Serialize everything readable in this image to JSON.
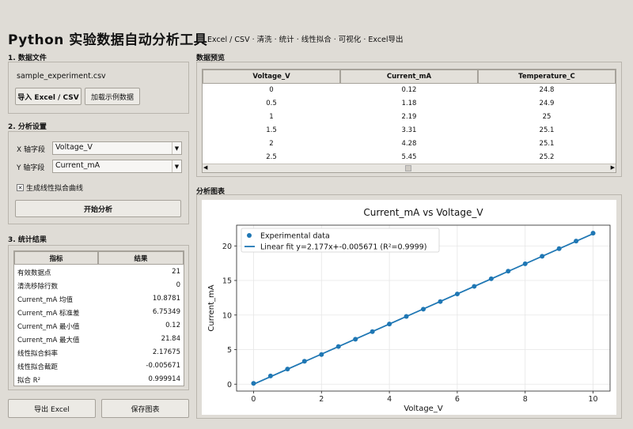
{
  "app": {
    "title": "Python 实验数据自动分析工具",
    "subtitle": "Excel / CSV · 清洗 · 统计 · 线性拟合 · 可视化 · Excel导出"
  },
  "data_file": {
    "section": "1. 数据文件",
    "filename": "sample_experiment.csv",
    "import_label": "导入 Excel / CSV",
    "load_sample_label": "加载示例数据"
  },
  "settings": {
    "section": "2. 分析设置",
    "x_label": "X 轴字段",
    "x_value": "Voltage_V",
    "y_label": "Y 轴字段",
    "y_value": "Current_mA",
    "fit_label": "生成线性拟合曲线",
    "fit_checked": true,
    "start_label": "开始分析"
  },
  "stats": {
    "section": "3. 统计结果",
    "headers": [
      "指标",
      "结果"
    ],
    "rows": [
      [
        "有效数据点",
        "21"
      ],
      [
        "清洗移除行数",
        "0"
      ],
      [
        "Current_mA 均值",
        "10.8781"
      ],
      [
        "Current_mA 标准差",
        "6.75349"
      ],
      [
        "Current_mA 最小值",
        "0.12"
      ],
      [
        "Current_mA 最大值",
        "21.84"
      ],
      [
        "线性拟合斜率",
        "2.17675"
      ],
      [
        "线性拟合截距",
        "-0.005671"
      ],
      [
        "拟合 R²",
        "0.999914"
      ]
    ]
  },
  "footer": {
    "export_label": "导出 Excel",
    "save_label": "保存图表"
  },
  "preview": {
    "section": "数据预览",
    "headers": [
      "Voltage_V",
      "Current_mA",
      "Temperature_C"
    ],
    "rows": [
      [
        "0",
        "0.12",
        "24.8"
      ],
      [
        "0.5",
        "1.18",
        "24.9"
      ],
      [
        "1",
        "2.19",
        "25"
      ],
      [
        "1.5",
        "3.31",
        "25.1"
      ],
      [
        "2",
        "4.28",
        "25.1"
      ],
      [
        "2.5",
        "5.45",
        "25.2"
      ]
    ]
  },
  "chart_section": "分析图表",
  "chart_data": {
    "type": "scatter",
    "title": "Current_mA vs Voltage_V",
    "xlabel": "Voltage_V",
    "ylabel": "Current_mA",
    "xlim": [
      -0.5,
      10.5
    ],
    "ylim": [
      -1,
      23
    ],
    "xticks": [
      0,
      2,
      4,
      6,
      8,
      10
    ],
    "yticks": [
      0,
      5,
      10,
      15,
      20
    ],
    "legend_position": "top-left",
    "grid": true,
    "series": [
      {
        "name": "Experimental data",
        "kind": "points",
        "color": "#1f77b4",
        "x": [
          0,
          0.5,
          1,
          1.5,
          2,
          2.5,
          3,
          3.5,
          4,
          4.5,
          5,
          5.5,
          6,
          6.5,
          7,
          7.5,
          8,
          8.5,
          9,
          9.5,
          10
        ],
        "y": [
          0.12,
          1.18,
          2.19,
          3.31,
          4.28,
          5.45,
          6.5,
          7.6,
          8.7,
          9.8,
          10.85,
          11.95,
          13.05,
          14.15,
          15.25,
          16.35,
          17.42,
          18.5,
          19.6,
          20.7,
          21.84
        ]
      },
      {
        "name": "Linear fit  y=2.177x+-0.005671  (R²=0.9999)",
        "kind": "line",
        "color": "#1f77b4",
        "slope": 2.17675,
        "intercept": -0.005671
      }
    ]
  }
}
